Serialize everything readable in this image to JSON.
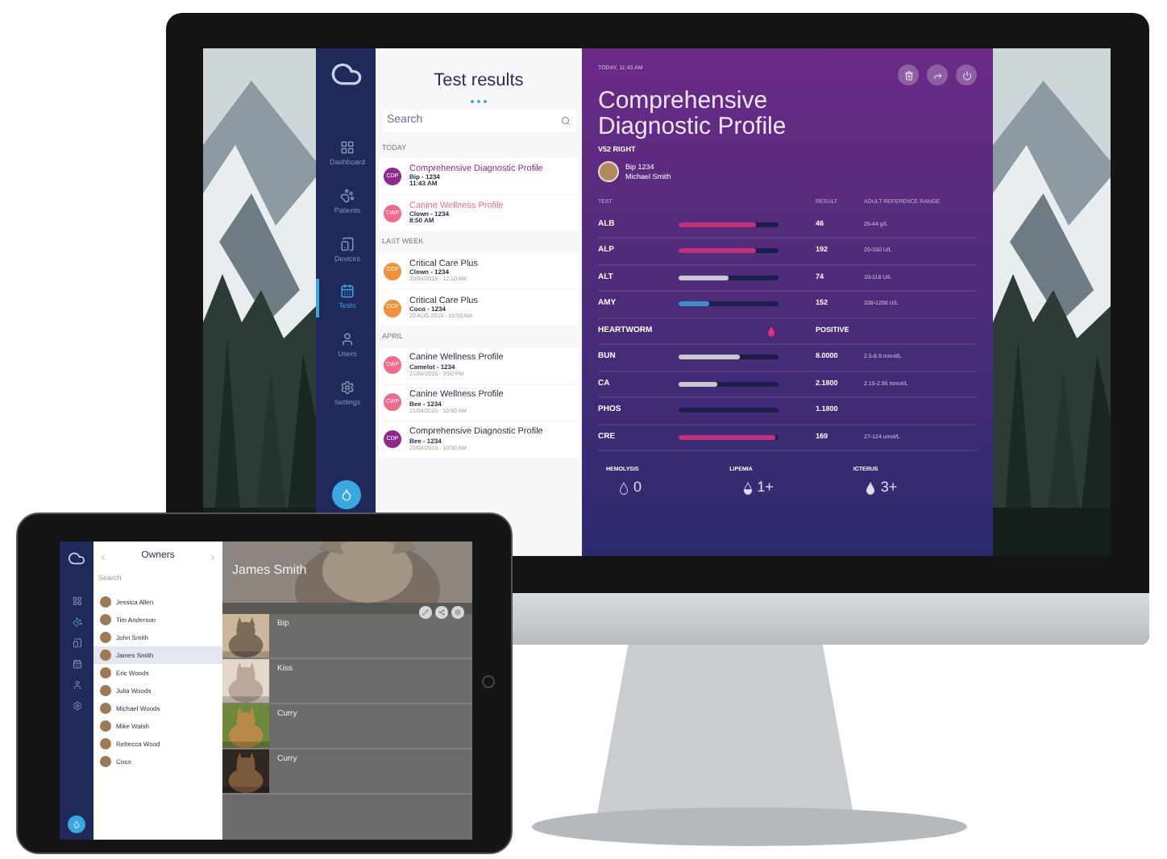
{
  "monitor": {
    "sidebar": {
      "items": [
        {
          "label": "Dashboard",
          "selected": false
        },
        {
          "label": "Patients",
          "selected": false
        },
        {
          "label": "Devices",
          "selected": false
        },
        {
          "label": "Tests",
          "selected": true
        },
        {
          "label": "Users",
          "selected": false
        },
        {
          "label": "Settings",
          "selected": false
        }
      ]
    },
    "list": {
      "title": "Test results",
      "search": {
        "placeholder": "Search"
      },
      "groups": [
        {
          "heading": "TODAY",
          "items": [
            {
              "badge": "CDP",
              "color": "#8e2a8e",
              "title": "Comprehensive Diagnostic Profile",
              "highlight": true,
              "patient": "Bip - 1234",
              "time": "11:43 AM"
            },
            {
              "badge": "CWP",
              "color": "#f06a8f",
              "title": "Canine Wellness Profile",
              "highlight": true,
              "patient": "Clown - 1234",
              "time": "8:50 AM"
            }
          ]
        },
        {
          "heading": "LAST WEEK",
          "items": [
            {
              "badge": "CCP",
              "color": "#f0923a",
              "title": "Critical Care Plus",
              "highlight": false,
              "patient": "Clown - 1234",
              "time": "20/04/2015 - 12:10 AM"
            },
            {
              "badge": "CCP",
              "color": "#f0923a",
              "title": "Critical Care Plus",
              "highlight": false,
              "patient": "Coco - 1234",
              "time": "20 AUG 2015 - 10:50 AM"
            }
          ]
        },
        {
          "heading": "APRIL",
          "items": [
            {
              "badge": "CWP",
              "color": "#f06a8f",
              "title": "Canine Wellness Profile",
              "highlight": false,
              "patient": "Camelot - 1234",
              "time": "21/04/2015 - 3:50 PM"
            },
            {
              "badge": "CWP",
              "color": "#f06a8f",
              "title": "Canine Wellness Profile",
              "highlight": false,
              "patient": "Bee - 1234",
              "time": "21/04/2015 - 10:50 AM"
            },
            {
              "badge": "CDP",
              "color": "#8e2a8e",
              "title": "Comprehensive Diagnostic Profile",
              "highlight": false,
              "patient": "Bee - 1234",
              "time": "21/04/2015 - 10:50 AM"
            }
          ]
        }
      ]
    },
    "detail": {
      "timestamp": "TODAY, 11:43 AM",
      "title": "Comprehensive Diagnostic Profile",
      "device": "V52 RIGHT",
      "patient": "Bip 1234",
      "owner": "Michael Smith",
      "columns": [
        "TEST",
        "RESULT",
        "ADULT REFERENCE RANGE"
      ],
      "rows": [
        {
          "kind": "bar",
          "name": "ALB",
          "level": 0.78,
          "color": "#c2307a",
          "result": "46",
          "range": "25-44 g/L"
        },
        {
          "kind": "bar",
          "name": "ALP",
          "level": 0.78,
          "color": "#c2307a",
          "result": "192",
          "range": "20-150 U/L"
        },
        {
          "kind": "bar",
          "name": "ALT",
          "level": 0.5,
          "color": "#c8c8d0",
          "result": "74",
          "range": "10-118 U/L"
        },
        {
          "kind": "bar",
          "name": "AMY",
          "level": 0.3,
          "color": "#3b8fc4",
          "result": "152",
          "range": "200-1200 U/L"
        },
        {
          "kind": "indicator",
          "name": "HEARTWORM",
          "color": "#e0307a",
          "result": "POSITIVE"
        },
        {
          "kind": "bar",
          "name": "BUN",
          "level": 0.62,
          "color": "#c8c8d0",
          "result": "8.0000",
          "range": "2.5-8.9 mmol/L"
        },
        {
          "kind": "bar",
          "name": "CA",
          "level": 0.38,
          "color": "#c8c8d0",
          "result": "2.1800",
          "range": "2.15-2.95 mmol/L"
        },
        {
          "kind": "bar",
          "name": "PHOS",
          "result": "1.1800"
        },
        {
          "kind": "bar",
          "name": "CRE",
          "level": 0.97,
          "color": "#c2307a",
          "result": "169",
          "range": "27-124 umol/L"
        }
      ],
      "indices": [
        {
          "label": "HEMOLYSIS",
          "value": "0",
          "kind": "empty"
        },
        {
          "label": "LIPEMIA",
          "value": "1+",
          "kind": "half"
        },
        {
          "label": "ICTERUS",
          "value": "3+",
          "kind": "full"
        }
      ]
    }
  },
  "tablet": {
    "list": {
      "title": "Owners",
      "search": {
        "placeholder": "Search"
      },
      "owners": [
        {
          "name": "Jessica Allen",
          "selected": false
        },
        {
          "name": "Tim Anderson",
          "selected": false
        },
        {
          "name": "John Smith",
          "selected": false
        },
        {
          "name": "James Smith",
          "selected": true
        },
        {
          "name": "Eric Woods",
          "selected": false
        },
        {
          "name": "Julia Woods",
          "selected": false
        },
        {
          "name": "Michael Woods",
          "selected": false
        },
        {
          "name": "Mike Walsh",
          "selected": false
        },
        {
          "name": "Rebecca Wood",
          "selected": false
        },
        {
          "name": "Coco",
          "selected": false
        }
      ]
    },
    "owner": {
      "name": "James Smith",
      "pets": [
        {
          "name": "Bip"
        },
        {
          "name": "Kiss"
        },
        {
          "name": "Curry"
        },
        {
          "name": "Curry"
        }
      ]
    }
  }
}
